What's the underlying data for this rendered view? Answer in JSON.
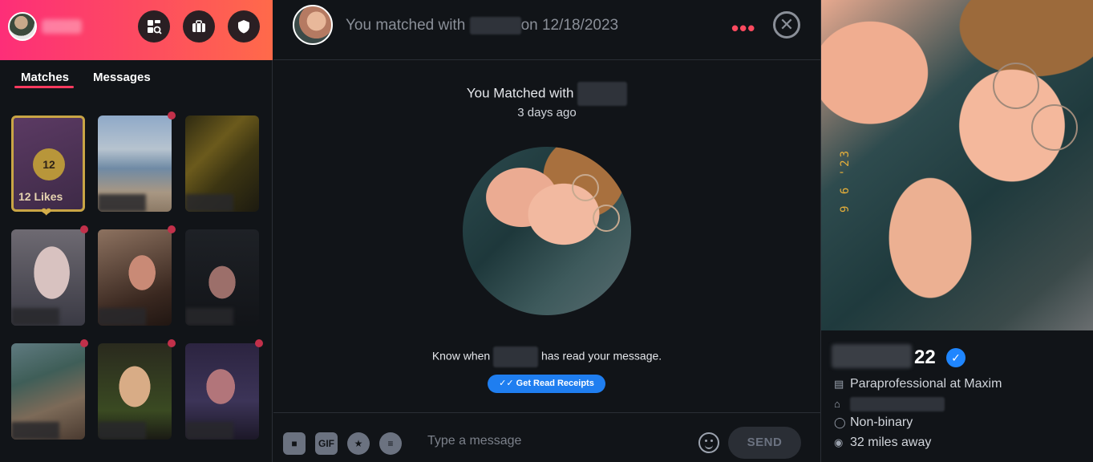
{
  "sidebar": {
    "tabs": [
      {
        "label": "Matches",
        "active": true
      },
      {
        "label": "Messages",
        "active": false
      }
    ],
    "likes_count": "12",
    "likes_label": "12 Likes",
    "header_icons": [
      "explore-icon",
      "briefcase-icon",
      "shield-icon"
    ]
  },
  "chat": {
    "header_prefix": "You matched with",
    "header_suffix": "on 12/18/2023",
    "match_title": "You Matched with",
    "match_time": "3 days ago",
    "receipt_prefix": "Know when",
    "receipt_suffix": "has read your message.",
    "receipt_button": "Get Read Receipts",
    "composer": {
      "gif_label": "GIF",
      "placeholder": "Type a message",
      "send_label": "SEND"
    }
  },
  "profile": {
    "age": "22",
    "job": "Paraprofessional at Maxim",
    "gender": "Non-binary",
    "distance": "32 miles away",
    "photo_stamp": "9 6 '23"
  },
  "colors": {
    "brand_gradient_start": "#fd2e78",
    "brand_gradient_end": "#ff6a4a",
    "accent_red": "#fd3a5f",
    "receipt_blue": "#1f7ef0",
    "verified_blue": "#1f86ff",
    "gold": "#c9a545"
  }
}
